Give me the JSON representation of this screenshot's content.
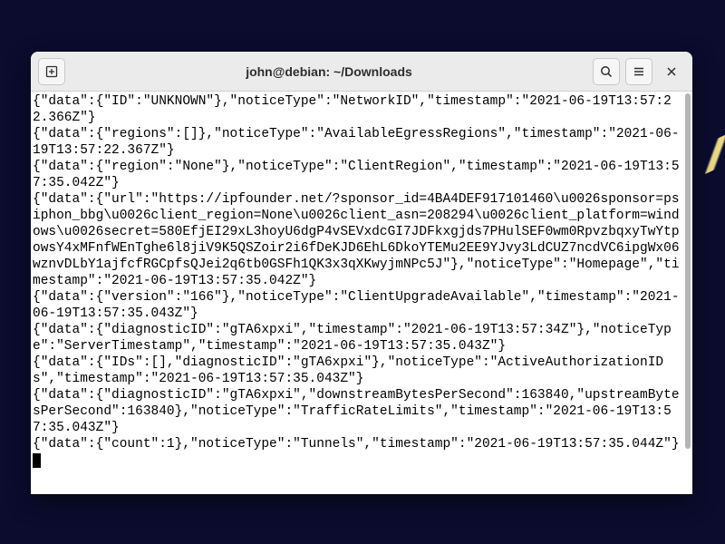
{
  "window": {
    "title": "john@debian: ~/Downloads"
  },
  "icons": {
    "new_tab": "new-tab-icon",
    "search": "search-icon",
    "menu": "hamburger-icon",
    "close": "close-icon"
  },
  "terminal": {
    "lines": [
      "{\"data\":{\"ID\":\"UNKNOWN\"},\"noticeType\":\"NetworkID\",\"timestamp\":\"2021-06-19T13:57:22.366Z\"}",
      "{\"data\":{\"regions\":[]},\"noticeType\":\"AvailableEgressRegions\",\"timestamp\":\"2021-06-19T13:57:22.367Z\"}",
      "{\"data\":{\"region\":\"None\"},\"noticeType\":\"ClientRegion\",\"timestamp\":\"2021-06-19T13:57:35.042Z\"}",
      "{\"data\":{\"url\":\"https://ipfounder.net/?sponsor_id=4BA4DEF917101460\\u0026sponsor=psiphon_bbg\\u0026client_region=None\\u0026client_asn=208294\\u0026client_platform=windows\\u0026secret=580EfjEI29xL3hoyU6dgP4vSEVxdcGI7JDFkxgjds7PHulSEF0wm0RpvzbqxyTwYtpowsY4xMFnfWEnTghe6l8jiV9K5QSZoir2i6fDeKJD6EhL6DkoYTEMu2EE9YJvy3LdCUZ7ncdVC6ipgWx06wznvDLbY1ajfcfRGCpfsQJei2q6tb0GSFh1QK3x3qXKwyjmNPc5J\"},\"noticeType\":\"Homepage\",\"timestamp\":\"2021-06-19T13:57:35.042Z\"}",
      "{\"data\":{\"version\":\"166\"},\"noticeType\":\"ClientUpgradeAvailable\",\"timestamp\":\"2021-06-19T13:57:35.043Z\"}",
      "{\"data\":{\"diagnosticID\":\"gTA6xpxi\",\"timestamp\":\"2021-06-19T13:57:34Z\"},\"noticeType\":\"ServerTimestamp\",\"timestamp\":\"2021-06-19T13:57:35.043Z\"}",
      "{\"data\":{\"IDs\":[],\"diagnosticID\":\"gTA6xpxi\"},\"noticeType\":\"ActiveAuthorizationIDs\",\"timestamp\":\"2021-06-19T13:57:35.043Z\"}",
      "{\"data\":{\"diagnosticID\":\"gTA6xpxi\",\"downstreamBytesPerSecond\":163840,\"upstreamBytesPerSecond\":163840},\"noticeType\":\"TrafficRateLimits\",\"timestamp\":\"2021-06-19T13:57:35.043Z\"}",
      "{\"data\":{\"count\":1},\"noticeType\":\"Tunnels\",\"timestamp\":\"2021-06-19T13:57:35.044Z\"}"
    ]
  }
}
